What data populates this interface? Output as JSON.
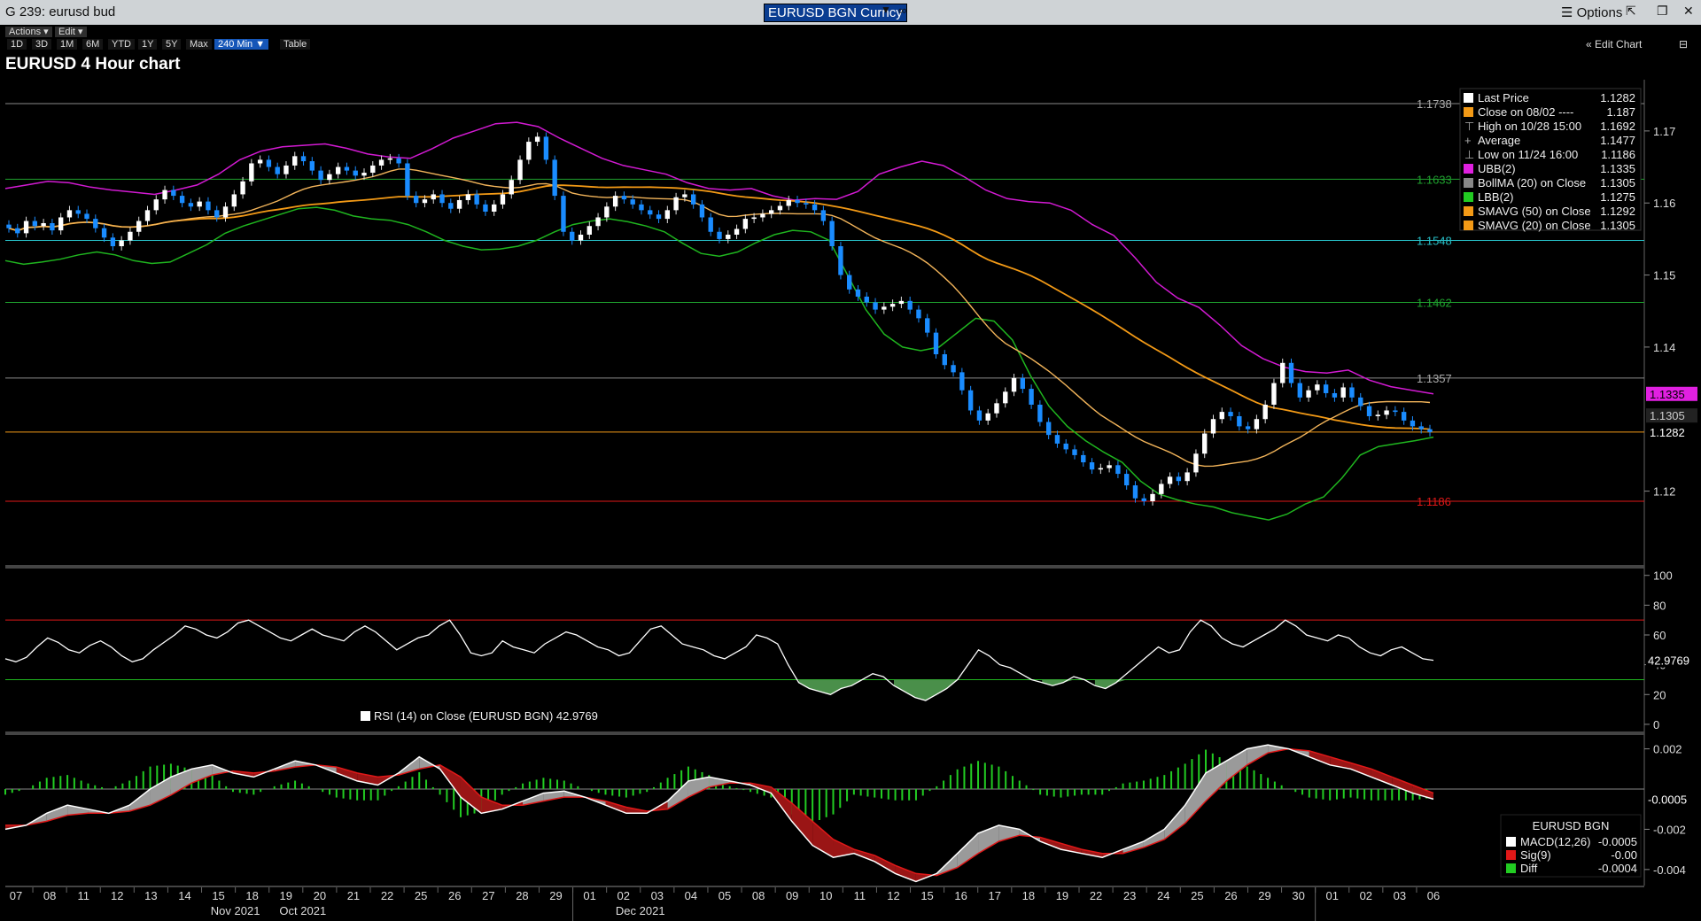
{
  "window": {
    "title": "G 239: eurusd bud",
    "ticker": "EURUSD BGN Curncy",
    "options_label": "Options"
  },
  "toolbar": {
    "actions": "Actions",
    "edit": "Edit",
    "ranges": [
      "1D",
      "3D",
      "1M",
      "6M",
      "YTD",
      "1Y",
      "5Y",
      "Max"
    ],
    "active_range": "240 Min",
    "table": "Table",
    "edit_chart": "Edit Chart"
  },
  "chart_data": [
    {
      "type": "candlestick",
      "title": "EURUSD 4 Hour chart",
      "y_ticks": [
        "1.17",
        "1.16",
        "1.15",
        "1.14",
        "1.12"
      ],
      "ylim": [
        1.1095,
        1.1765
      ],
      "x_dates": [
        "07",
        "08",
        "11",
        "12",
        "13",
        "14",
        "15",
        "18",
        "19",
        "20",
        "21",
        "22",
        "25",
        "26",
        "27",
        "28",
        "29",
        "01",
        "02",
        "03",
        "04",
        "05",
        "08",
        "09",
        "10",
        "11",
        "12",
        "15",
        "16",
        "17",
        "18",
        "19",
        "22",
        "23",
        "24",
        "25",
        "26",
        "29",
        "30",
        "01",
        "02",
        "03",
        "06"
      ],
      "month_labels": [
        {
          "label": "Oct 2021",
          "at": "19"
        },
        {
          "label": "Nov 2021",
          "at": "15"
        },
        {
          "label": "Dec 2021",
          "at": "02"
        }
      ],
      "h_lines": [
        {
          "value": 1.1738,
          "label": "1.1738",
          "color": "#8a8a8a"
        },
        {
          "value": 1.1633,
          "label": "1.1633",
          "color": "#1fa02e"
        },
        {
          "value": 1.1548,
          "label": "1.1548",
          "color": "#27c0c8"
        },
        {
          "value": 1.1462,
          "label": "1.1462",
          "color": "#1fa02e"
        },
        {
          "value": 1.1357,
          "label": "1.1357",
          "color": "#8a8a8a"
        },
        {
          "value": 1.1186,
          "label": "1.1186",
          "color": "#e01818"
        }
      ],
      "last_price_line": 1.1282,
      "right_tags": [
        {
          "label": "1.1335",
          "value": 1.1335,
          "bg": "#e020e0",
          "fg": "#000"
        },
        {
          "label": "1.1305",
          "value": 1.1305,
          "bg": "#222",
          "fg": "#ccc"
        },
        {
          "label": "1.1282",
          "value": 1.1282,
          "bg": "#000",
          "fg": "#fff"
        }
      ],
      "legend": [
        {
          "label": "Last Price",
          "value": "1.1282",
          "swatch": "#ffffff"
        },
        {
          "label": "Close on 08/02 ----",
          "value": "1.187",
          "swatch": "#f39a16"
        },
        {
          "label": "High on 10/28 15:00",
          "value": "1.1692",
          "swatch": "none",
          "glyph": "⊤"
        },
        {
          "label": "Average",
          "value": "1.1477",
          "swatch": "none",
          "glyph": "+"
        },
        {
          "label": "Low on 11/24 16:00",
          "value": "1.1186",
          "swatch": "none",
          "glyph": "⊥"
        },
        {
          "label": "UBB(2)",
          "value": "1.1335",
          "swatch": "#e020e0"
        },
        {
          "label": "BollMA (20)  on Close",
          "value": "1.1305",
          "swatch": "#888888"
        },
        {
          "label": "LBB(2)",
          "value": "1.1275",
          "swatch": "#22cc22"
        },
        {
          "label": "SMAVG (50)  on Close",
          "value": "1.1292",
          "swatch": "#f39a16"
        },
        {
          "label": "SMAVG (20)  on Close",
          "value": "1.1305",
          "swatch": "#f39a16"
        }
      ],
      "close_series": [
        1.1565,
        1.1558,
        1.1575,
        1.1568,
        1.1572,
        1.1562,
        1.158,
        1.159,
        1.1585,
        1.1578,
        1.1565,
        1.1552,
        1.154,
        1.1548,
        1.156,
        1.1575,
        1.159,
        1.1605,
        1.1618,
        1.161,
        1.16,
        1.1595,
        1.1602,
        1.159,
        1.158,
        1.1595,
        1.1612,
        1.163,
        1.1655,
        1.166,
        1.165,
        1.164,
        1.1652,
        1.1665,
        1.1658,
        1.1645,
        1.1632,
        1.164,
        1.165,
        1.1645,
        1.1638,
        1.1642,
        1.1652,
        1.166,
        1.1662,
        1.1655,
        1.161,
        1.16,
        1.1605,
        1.1612,
        1.16,
        1.1592,
        1.1604,
        1.1612,
        1.1598,
        1.1588,
        1.1598,
        1.1612,
        1.1632,
        1.166,
        1.1685,
        1.1692,
        1.166,
        1.161,
        1.156,
        1.1548,
        1.1556,
        1.1568,
        1.158,
        1.1595,
        1.161,
        1.1605,
        1.1598,
        1.159,
        1.1584,
        1.1578,
        1.159,
        1.1608,
        1.1612,
        1.1598,
        1.158,
        1.156,
        1.155,
        1.1556,
        1.1564,
        1.1578,
        1.158,
        1.1585,
        1.159,
        1.1596,
        1.1604,
        1.16,
        1.1598,
        1.159,
        1.1575,
        1.154,
        1.15,
        1.148,
        1.147,
        1.1462,
        1.1452,
        1.1456,
        1.146,
        1.1464,
        1.1452,
        1.144,
        1.142,
        1.139,
        1.1375,
        1.1365,
        1.134,
        1.1312,
        1.1298,
        1.1308,
        1.1322,
        1.1338,
        1.1357,
        1.1342,
        1.132,
        1.1296,
        1.1278,
        1.1266,
        1.1258,
        1.125,
        1.124,
        1.123,
        1.1232,
        1.1236,
        1.1224,
        1.1208,
        1.119,
        1.1186,
        1.1196,
        1.121,
        1.122,
        1.1214,
        1.1226,
        1.1252,
        1.128,
        1.13,
        1.131,
        1.1304,
        1.129,
        1.1286,
        1.13,
        1.132,
        1.135,
        1.1378,
        1.135,
        1.133,
        1.134,
        1.1348,
        1.1336,
        1.133,
        1.1344,
        1.133,
        1.1318,
        1.1304,
        1.1306,
        1.1312,
        1.131,
        1.1298,
        1.129,
        1.1286,
        1.1282
      ],
      "ubb_series": [
        1.162,
        1.1625,
        1.163,
        1.1628,
        1.1622,
        1.1618,
        1.1615,
        1.1612,
        1.1618,
        1.1625,
        1.164,
        1.166,
        1.1672,
        1.1678,
        1.168,
        1.1682,
        1.1676,
        1.1668,
        1.1664,
        1.1662,
        1.1675,
        1.169,
        1.17,
        1.171,
        1.1712,
        1.1706,
        1.169,
        1.1676,
        1.1662,
        1.1652,
        1.1646,
        1.164,
        1.1628,
        1.162,
        1.1618,
        1.162,
        1.161,
        1.1604,
        1.1606,
        1.1605,
        1.1616,
        1.164,
        1.165,
        1.1658,
        1.1652,
        1.1636,
        1.1618,
        1.1606,
        1.1602,
        1.16,
        1.159,
        1.157,
        1.1555,
        1.1524,
        1.149,
        1.1468,
        1.1455,
        1.143,
        1.1402,
        1.1384,
        1.1372,
        1.1366,
        1.1364,
        1.1368,
        1.1354,
        1.1345,
        1.134,
        1.1335
      ],
      "lbb_series": [
        1.152,
        1.1515,
        1.1518,
        1.1522,
        1.1528,
        1.1532,
        1.1528,
        1.152,
        1.1516,
        1.1518,
        1.153,
        1.1542,
        1.1558,
        1.1568,
        1.1576,
        1.1584,
        1.1592,
        1.1594,
        1.159,
        1.1582,
        1.1578,
        1.1576,
        1.157,
        1.156,
        1.1548,
        1.154,
        1.1535,
        1.1536,
        1.154,
        1.1548,
        1.156,
        1.157,
        1.1575,
        1.1578,
        1.1574,
        1.1568,
        1.156,
        1.1544,
        1.153,
        1.1526,
        1.1532,
        1.1545,
        1.1556,
        1.1562,
        1.156,
        1.1548,
        1.15,
        1.1452,
        1.1418,
        1.14,
        1.1395,
        1.14,
        1.142,
        1.144,
        1.1436,
        1.141,
        1.136,
        1.1318,
        1.129,
        1.127,
        1.1254,
        1.124,
        1.1214,
        1.1196,
        1.1188,
        1.1182,
        1.1178,
        1.117,
        1.1165,
        1.116,
        1.1168,
        1.1182,
        1.1192,
        1.1218,
        1.125,
        1.1262,
        1.1266,
        1.127,
        1.1275
      ]
    },
    {
      "type": "line",
      "name": "RSI (14)",
      "legend_label": "RSI (14)   on Close (EURUSD BGN) 42.9769",
      "last_value": "42.9769",
      "y_ticks": [
        "100",
        "80",
        "60",
        "40",
        "20",
        "0"
      ],
      "ylim": [
        -6,
        104
      ],
      "upper_band": 70,
      "lower_band": 30,
      "values": [
        44,
        42,
        45,
        52,
        58,
        55,
        50,
        48,
        53,
        56,
        52,
        46,
        42,
        44,
        50,
        55,
        60,
        66,
        64,
        60,
        58,
        62,
        68,
        70,
        66,
        62,
        58,
        56,
        60,
        64,
        60,
        58,
        56,
        62,
        66,
        62,
        56,
        50,
        54,
        58,
        60,
        66,
        70,
        60,
        48,
        46,
        48,
        56,
        52,
        50,
        48,
        54,
        58,
        62,
        60,
        56,
        52,
        50,
        46,
        48,
        56,
        64,
        66,
        60,
        54,
        52,
        50,
        46,
        44,
        48,
        52,
        60,
        58,
        54,
        40,
        28,
        24,
        22,
        20,
        24,
        26,
        30,
        34,
        32,
        26,
        22,
        18,
        16,
        20,
        24,
        30,
        40,
        50,
        46,
        40,
        38,
        34,
        30,
        28,
        26,
        28,
        32,
        30,
        26,
        24,
        28,
        34,
        40,
        46,
        52,
        48,
        50,
        62,
        70,
        66,
        58,
        54,
        52,
        56,
        60,
        64,
        70,
        66,
        60,
        58,
        56,
        60,
        58,
        52,
        48,
        46,
        50,
        52,
        48,
        44,
        43
      ]
    },
    {
      "type": "bar+line",
      "name": "MACD",
      "legend_title": "EURUSD BGN",
      "y_ticks": [
        "0.002",
        "-0.002",
        "-0.004"
      ],
      "ylim": [
        -0.0048,
        0.0026
      ],
      "last_value": "-0.0005",
      "legend": [
        {
          "label": "MACD(12,26)",
          "value": "-0.0005",
          "swatch": "#ffffff"
        },
        {
          "label": "Sig(9)",
          "value": "-0.00",
          "swatch": "#e01818"
        },
        {
          "label": "Diff",
          "value": "-0.0004",
          "swatch": "#22cc22"
        }
      ],
      "macd": [
        -0.002,
        -0.0018,
        -0.0012,
        -0.0008,
        -0.001,
        -0.0012,
        -0.0008,
        0.0,
        0.0006,
        0.001,
        0.0012,
        0.0008,
        0.0006,
        0.001,
        0.0014,
        0.0012,
        0.0008,
        0.0004,
        0.0002,
        0.0008,
        0.0016,
        0.001,
        -0.0004,
        -0.0012,
        -0.001,
        -0.0006,
        -0.0002,
        -0.0001,
        -0.0004,
        -0.0008,
        -0.0012,
        -0.0012,
        -0.0006,
        0.0004,
        0.0006,
        0.0004,
        0.0002,
        -0.0002,
        -0.0016,
        -0.0028,
        -0.0034,
        -0.0032,
        -0.0036,
        -0.0042,
        -0.0046,
        -0.0042,
        -0.0032,
        -0.0022,
        -0.0018,
        -0.002,
        -0.0026,
        -0.003,
        -0.0032,
        -0.0034,
        -0.003,
        -0.0026,
        -0.002,
        -0.0008,
        0.0008,
        0.0014,
        0.002,
        0.0022,
        0.002,
        0.0016,
        0.0012,
        0.001,
        0.0006,
        0.0002,
        -0.0002,
        -0.0005
      ],
      "signal": [
        -0.0018,
        -0.0018,
        -0.0016,
        -0.0013,
        -0.0012,
        -0.0012,
        -0.0011,
        -0.0008,
        -0.0003,
        0.0003,
        0.0007,
        0.0009,
        0.0008,
        0.0009,
        0.0011,
        0.0012,
        0.0011,
        0.0008,
        0.0006,
        0.0007,
        0.001,
        0.0012,
        0.0006,
        -0.0004,
        -0.0008,
        -0.0008,
        -0.0006,
        -0.0004,
        -0.0004,
        -0.0006,
        -0.0009,
        -0.0011,
        -0.001,
        -0.0004,
        0.0001,
        0.0003,
        0.0003,
        0.0001,
        -0.0007,
        -0.0016,
        -0.0025,
        -0.003,
        -0.0033,
        -0.0038,
        -0.0042,
        -0.0043,
        -0.0039,
        -0.0032,
        -0.0026,
        -0.0023,
        -0.0024,
        -0.0027,
        -0.003,
        -0.0032,
        -0.0032,
        -0.0029,
        -0.0025,
        -0.0017,
        -0.0006,
        0.0004,
        0.0012,
        0.0018,
        0.002,
        0.0019,
        0.0016,
        0.0013,
        0.001,
        0.0006,
        0.0002,
        -0.0002
      ]
    }
  ]
}
